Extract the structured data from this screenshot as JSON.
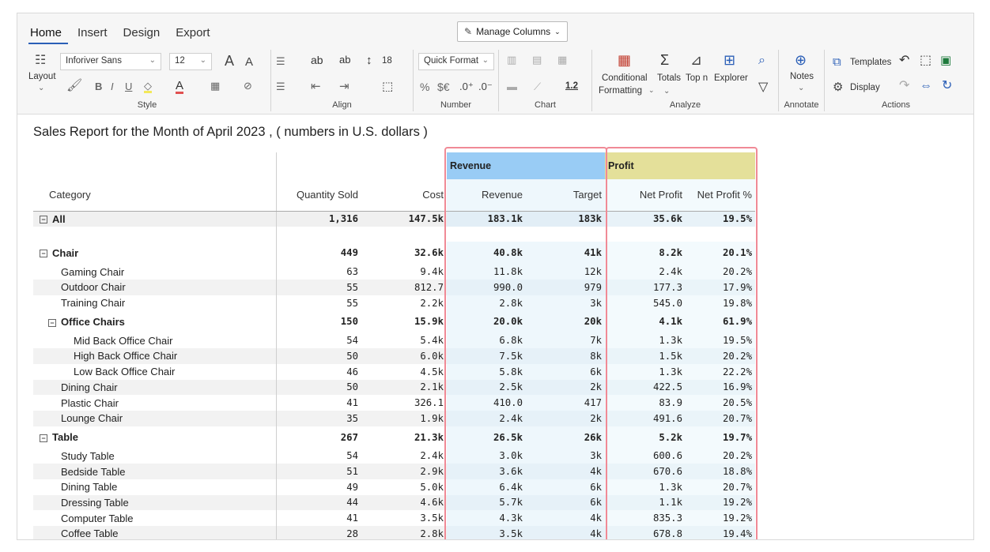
{
  "ribbon": {
    "tabs": [
      "Home",
      "Insert",
      "Design",
      "Export"
    ],
    "manage_columns": "Manage Columns",
    "style": {
      "layout": "Layout",
      "font": "Inforiver Sans",
      "font_size": "12",
      "label": "Style"
    },
    "align": {
      "line_height": "18",
      "label": "Align"
    },
    "number": {
      "quick_format": "Quick Format",
      "label": "Number"
    },
    "chart": {
      "ratio": "1.2",
      "label": "Chart"
    },
    "analyze": {
      "conditional": "Conditional",
      "formatting": "Formatting",
      "totals": "Totals",
      "topn": "Top n",
      "explorer": "Explorer",
      "label": "Analyze"
    },
    "annotate": {
      "notes": "Notes",
      "label": "Annotate"
    },
    "actions": {
      "templates": "Templates",
      "display": "Display",
      "label": "Actions"
    }
  },
  "report": {
    "title": "Sales Report for the Month of April 2023 , ( numbers in U.S. dollars )",
    "groups": {
      "revenue": "Revenue",
      "profit": "Profit"
    },
    "headers": [
      "Category",
      "Quantity Sold",
      "Cost",
      "Revenue",
      "Target",
      "Net Profit",
      "Net Profit %"
    ],
    "rows": [
      {
        "type": "all",
        "label": "All",
        "qty": "1,316",
        "cost": "147.5k",
        "rev": "183.1k",
        "target": "183k",
        "np": "35.6k",
        "npp": "19.5%"
      },
      {
        "type": "gap"
      },
      {
        "type": "grp",
        "label": "Chair",
        "qty": "449",
        "cost": "32.6k",
        "rev": "40.8k",
        "target": "41k",
        "np": "8.2k",
        "npp": "20.1%"
      },
      {
        "type": "item",
        "level": 1,
        "label": "Gaming Chair",
        "qty": "63",
        "cost": "9.4k",
        "rev": "11.8k",
        "target": "12k",
        "np": "2.4k",
        "npp": "20.2%"
      },
      {
        "type": "item",
        "level": 1,
        "label": "Outdoor Chair",
        "qty": "55",
        "cost": "812.7",
        "rev": "990.0",
        "target": "979",
        "np": "177.3",
        "npp": "17.9%"
      },
      {
        "type": "item",
        "level": 1,
        "label": "Training Chair",
        "qty": "55",
        "cost": "2.2k",
        "rev": "2.8k",
        "target": "3k",
        "np": "545.0",
        "npp": "19.8%"
      },
      {
        "type": "subgrp",
        "label": "Office Chairs",
        "qty": "150",
        "cost": "15.9k",
        "rev": "20.0k",
        "target": "20k",
        "np": "4.1k",
        "npp": "61.9%"
      },
      {
        "type": "item",
        "level": 2,
        "label": "Mid Back Office Chair",
        "qty": "54",
        "cost": "5.4k",
        "rev": "6.8k",
        "target": "7k",
        "np": "1.3k",
        "npp": "19.5%"
      },
      {
        "type": "item",
        "level": 2,
        "label": "High Back Office Chair",
        "qty": "50",
        "cost": "6.0k",
        "rev": "7.5k",
        "target": "8k",
        "np": "1.5k",
        "npp": "20.2%"
      },
      {
        "type": "item",
        "level": 2,
        "label": "Low Back Office Chair",
        "qty": "46",
        "cost": "4.5k",
        "rev": "5.8k",
        "target": "6k",
        "np": "1.3k",
        "npp": "22.2%"
      },
      {
        "type": "item",
        "level": 1,
        "label": "Dining Chair",
        "qty": "50",
        "cost": "2.1k",
        "rev": "2.5k",
        "target": "2k",
        "np": "422.5",
        "npp": "16.9%"
      },
      {
        "type": "item",
        "level": 1,
        "label": "Plastic Chair",
        "qty": "41",
        "cost": "326.1",
        "rev": "410.0",
        "target": "417",
        "np": "83.9",
        "npp": "20.5%"
      },
      {
        "type": "item",
        "level": 1,
        "label": "Lounge Chair",
        "qty": "35",
        "cost": "1.9k",
        "rev": "2.4k",
        "target": "2k",
        "np": "491.6",
        "npp": "20.7%"
      },
      {
        "type": "grp",
        "label": "Table",
        "qty": "267",
        "cost": "21.3k",
        "rev": "26.5k",
        "target": "26k",
        "np": "5.2k",
        "npp": "19.7%"
      },
      {
        "type": "item",
        "level": 1,
        "label": "Study Table",
        "qty": "54",
        "cost": "2.4k",
        "rev": "3.0k",
        "target": "3k",
        "np": "600.6",
        "npp": "20.2%"
      },
      {
        "type": "item",
        "level": 1,
        "label": "Bedside Table",
        "qty": "51",
        "cost": "2.9k",
        "rev": "3.6k",
        "target": "4k",
        "np": "670.6",
        "npp": "18.8%"
      },
      {
        "type": "item",
        "level": 1,
        "label": "Dining Table",
        "qty": "49",
        "cost": "5.0k",
        "rev": "6.4k",
        "target": "6k",
        "np": "1.3k",
        "npp": "20.7%"
      },
      {
        "type": "item",
        "level": 1,
        "label": "Dressing Table",
        "qty": "44",
        "cost": "4.6k",
        "rev": "5.7k",
        "target": "6k",
        "np": "1.1k",
        "npp": "19.2%"
      },
      {
        "type": "item",
        "level": 1,
        "label": "Computer Table",
        "qty": "41",
        "cost": "3.5k",
        "rev": "4.3k",
        "target": "4k",
        "np": "835.3",
        "npp": "19.2%"
      },
      {
        "type": "item",
        "level": 1,
        "label": "Coffee Table",
        "qty": "28",
        "cost": "2.8k",
        "rev": "3.5k",
        "target": "4k",
        "np": "678.8",
        "npp": "19.4%"
      }
    ]
  },
  "colors": {
    "revenue_band": "#99ccf5",
    "profit_band": "#e4e09a",
    "highlight": "#f08a96",
    "accent": "#2b5fb7"
  }
}
